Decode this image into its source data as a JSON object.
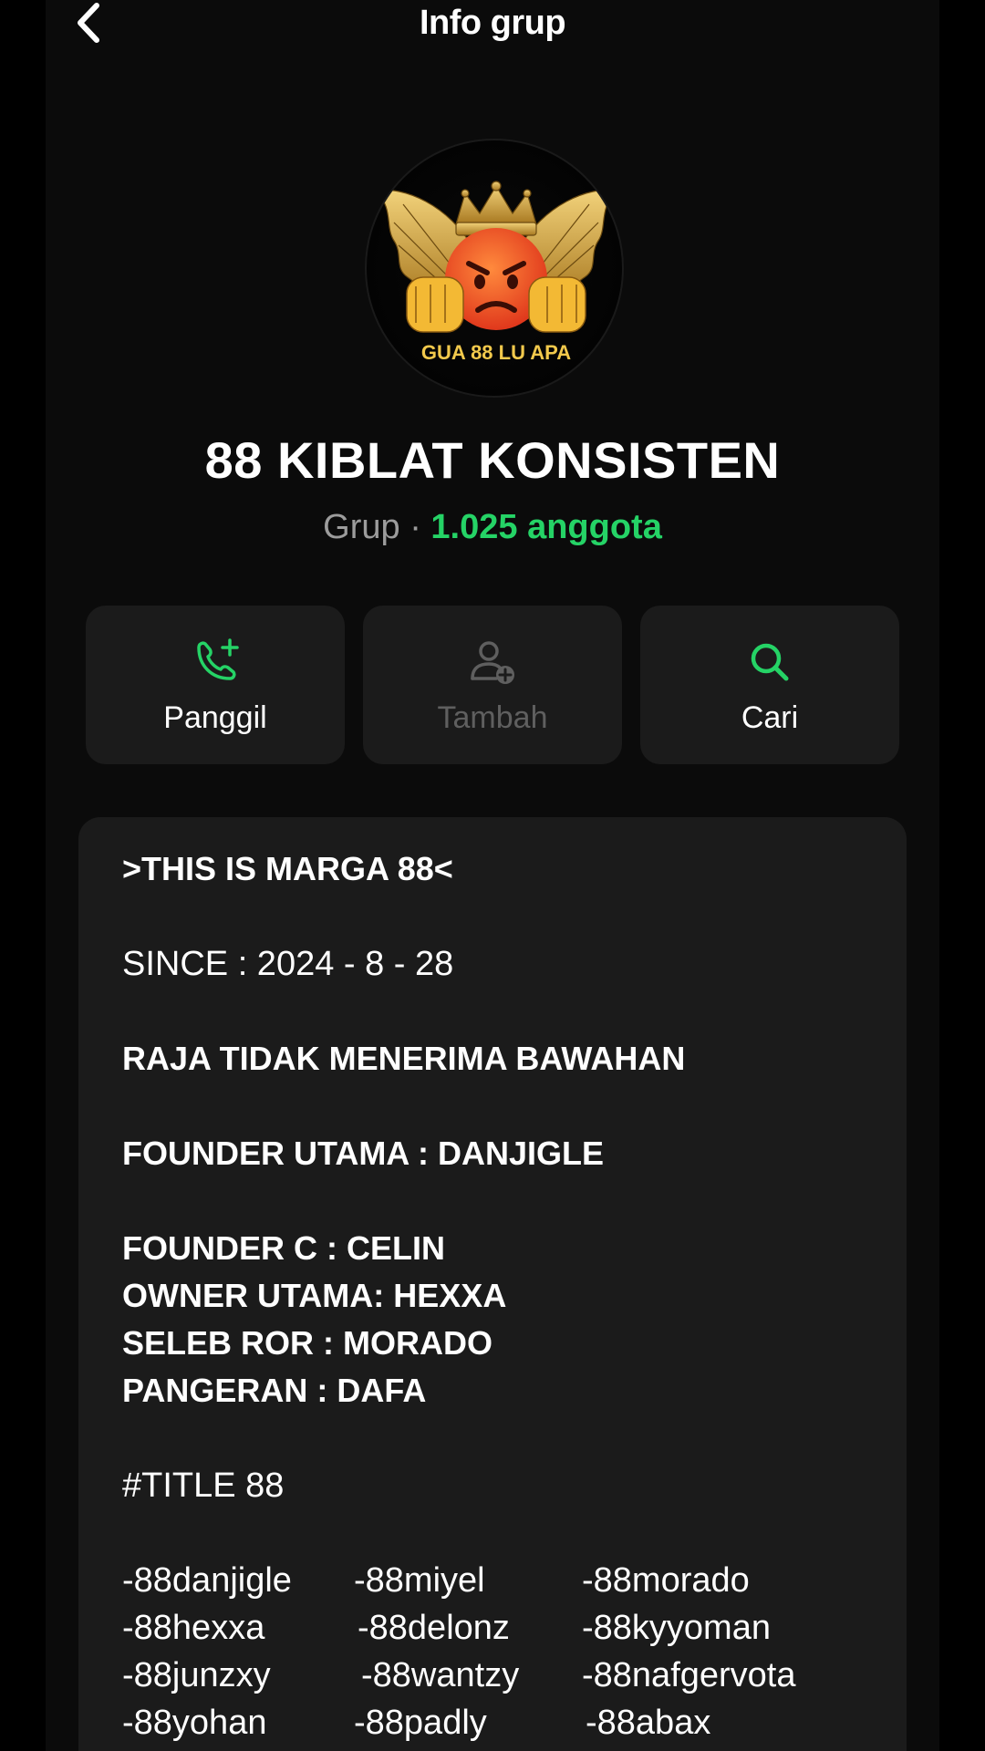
{
  "header": {
    "title": "Info grup",
    "back_icon": "chevron-left-icon"
  },
  "avatar": {
    "badge_text": "GUA 88 LU APA"
  },
  "group": {
    "name": "88 KIBLAT KONSISTEN",
    "type": "Grup",
    "separator": " · ",
    "members": "1.025 anggota"
  },
  "actions": [
    {
      "label": "Panggil",
      "icon": "phone-plus-icon",
      "enabled": true
    },
    {
      "label": "Tambah",
      "icon": "add-person-icon",
      "enabled": false
    },
    {
      "label": "Cari",
      "icon": "search-icon",
      "enabled": true
    }
  ],
  "description": {
    "line1": ">THIS IS MARGA 88<",
    "line2": "SINCE : 2024 - 8 - 28",
    "line3": "RAJA TIDAK MENERIMA BAWAHAN",
    "line4": "FOUNDER UTAMA : DANJIGLE",
    "line5": "FOUNDER C : CELIN",
    "line6": "OWNER UTAMA: HEXXA",
    "line7": "SELEB ROR : MORADO",
    "line8": "PANGERAN : DAFA",
    "line9": "#TITLE 88",
    "members": [
      [
        "-88danjigle",
        "-88miyel",
        "-88morado"
      ],
      [
        "-88hexxa",
        "-88delonz",
        "-88kyyoman"
      ],
      [
        "-88junzxy",
        "-88wantzy",
        "-88nafgervota"
      ],
      [
        "-88yohan",
        "-88padly",
        "-88abax"
      ]
    ]
  },
  "colors": {
    "accent_green": "#25d366",
    "card_bg": "#1b1b1b",
    "muted_text": "#9c9c9c",
    "disabled_text": "#5f5f5f"
  }
}
